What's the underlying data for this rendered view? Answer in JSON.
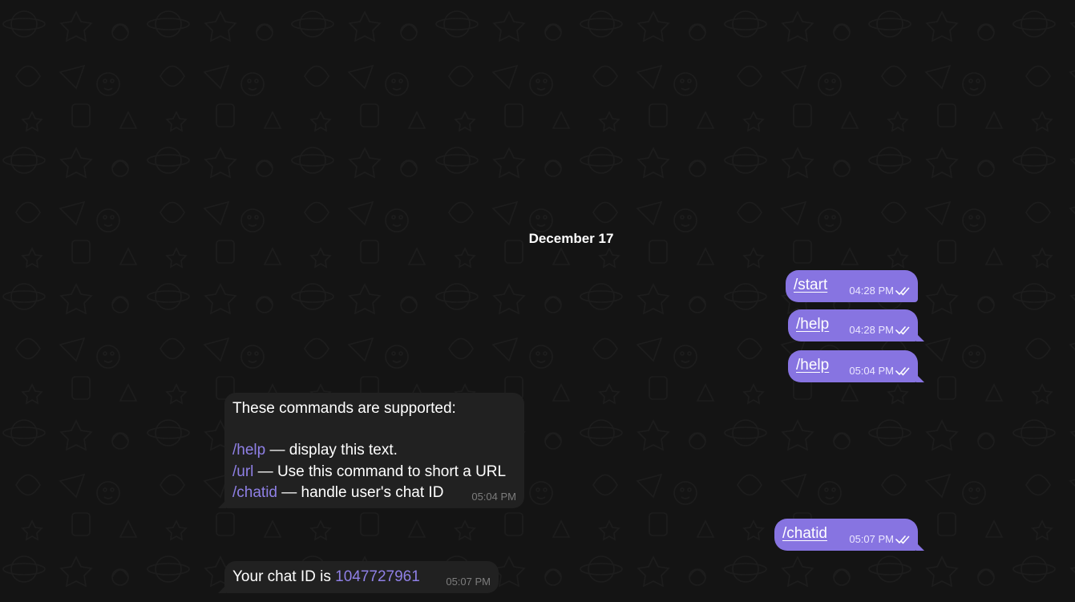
{
  "theme": {
    "background": "#141414",
    "outgoing_bubble": "#8774e1",
    "incoming_bubble": "#212121",
    "command_link": "#8f80e6"
  },
  "date_separator": "December 17",
  "messages": [
    {
      "direction": "out",
      "text": "/start",
      "time": "04:28 PM",
      "status": "double-check-icon"
    },
    {
      "direction": "out",
      "text": "/help",
      "time": "04:28 PM",
      "status": "double-check-icon"
    },
    {
      "direction": "out",
      "text": "/help",
      "time": "05:04 PM",
      "status": "double-check-icon"
    },
    {
      "direction": "in",
      "intro": "These commands are supported:",
      "commands": [
        {
          "cmd": "/help",
          "desc": " — display this text."
        },
        {
          "cmd": "/url",
          "desc": " — Use this command to short a URL"
        },
        {
          "cmd": "/chatid",
          "desc": " — handle user's chat ID"
        }
      ],
      "time": "05:04 PM"
    },
    {
      "direction": "out",
      "text": "/chatid",
      "time": "05:07 PM",
      "status": "double-check-icon"
    },
    {
      "direction": "in",
      "prefix": "Your chat ID is ",
      "chat_id": "1047727961",
      "time": "05:07 PM"
    }
  ]
}
